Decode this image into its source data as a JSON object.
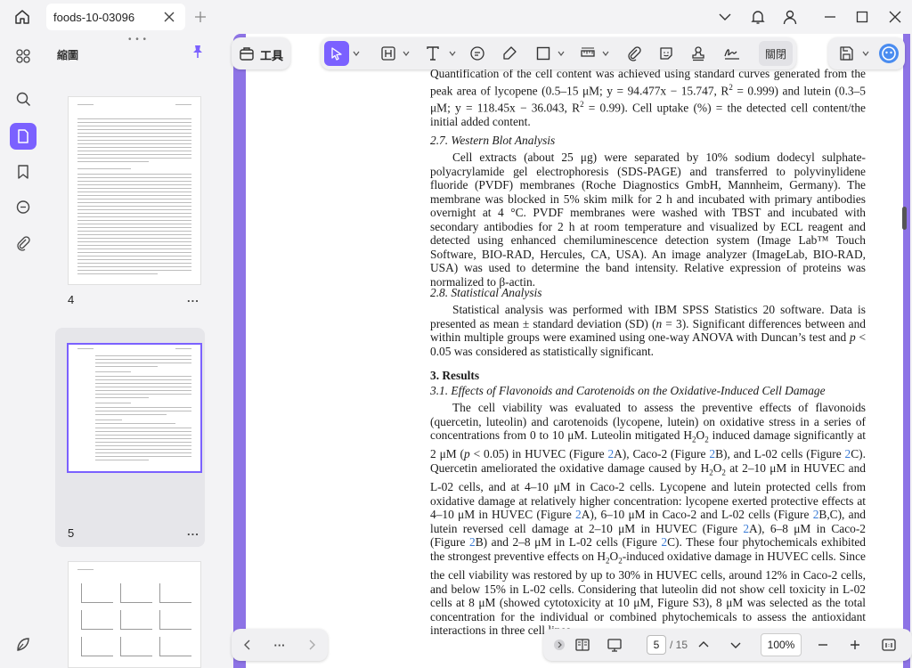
{
  "window": {
    "tab_title": "foods-10-03096"
  },
  "sidebar": {
    "title": "縮圖",
    "thumbnails": [
      {
        "page": "4",
        "more": "..."
      },
      {
        "page": "5",
        "more": "..."
      }
    ]
  },
  "toolbar": {
    "tools_label": "工具",
    "close_label": "關閉"
  },
  "document": {
    "p1": "Quantification of the cell content was achieved using standard curves generated from the peak area of lycopene (0.5–15 μM; y = 94.477x − 15.747, R",
    "p1_sup1": "2",
    "p1_b": " = 0.999) and lutein (0.3–5 μM; y = 118.45x − 36.043, R",
    "p1_sup2": "2",
    "p1_c": " = 0.99).  Cell uptake (%) = the detected cell content/the initial added content.",
    "s27": "2.7. Western Blot Analysis",
    "p2": "Cell extracts (about 25 μg) were separated by 10% sodium dodecyl sulphate-polyacrylamide gel electrophoresis (SDS-PAGE) and transferred to polyvinylidene fluoride (PVDF) membranes (Roche Diagnostics GmbH, Mannheim, Germany). The membrane was blocked in 5% skim milk for 2 h and incubated with primary antibodies overnight at 4 °C. PVDF membranes were washed with TBST and incubated with secondary antibodies for 2 h at room temperature and visualized by ECL reagent and detected using enhanced chemiluminescence detection system (Image Lab™ Touch Software, BIO-RAD, Hercules, CA, USA). An image analyzer (ImageLab, BIO-RAD, USA) was used to determine the band intensity. Relative expression of proteins was normalized to β-actin.",
    "s28": "2.8. Statistical Analysis",
    "p3a": "Statistical analysis was performed with IBM SPSS Statistics 20 software.  Data is presented as mean ± standard deviation (SD) (",
    "p3n": "n",
    "p3b": " = 3). Significant differences between and within multiple groups were examined using one-way ANOVA with Duncan’s test and ",
    "p3p": "p",
    "p3c": " < 0.05 was considered as statistically significant.",
    "h3": "3. Results",
    "s31": "3.1. Effects of Flavonoids and Carotenoids on the Oxidative-Induced Cell Damage",
    "p4_1": "The cell viability was evaluated to assess the preventive effects of flavonoids (quercetin, luteolin) and carotenoids (lycopene, lutein) on oxidative stress in a series of concentrations from 0 to 10 μM. Luteolin mitigated H",
    "p4_2": "O",
    "p4_3": " induced damage significantly at 2 μM (",
    "p4_p": "p",
    "p4_4": " < 0.05) in HUVEC (Figure ",
    "fig2": "2",
    "p4_5": "A), Caco-2 (Figure ",
    "p4_6": "B), and L-02 cells (Figure ",
    "p4_7": "C). Quercetin ameliorated the oxidative damage caused by H",
    "p4_8": " at 2–10 μM in HUVEC and L-02 cells, and at 4–10 μM in Caco-2 cells. Lycopene and lutein protected cells from oxidative damage at relatively higher concentration: lycopene exerted protective effects at 4–10 μM in HUVEC (Figure ",
    "p4_9": "A), 6–10 μM in Caco-2 and L-02 cells (Figure ",
    "p4_10": "B,C), and lutein reversed cell damage at 2–10 μM in HUVEC (Figure ",
    "p4_11": "A), 6–8 μM in Caco-2 (Figure ",
    "p4_12": "B) and 2–8 μM in L-02 cells (Figure ",
    "p4_13": "C). These four phytochemicals exhibited the strongest preventive effects on H",
    "p4_14": "-induced oxidative damage in HUVEC cells. Since the cell viability was restored by up to 30% in HUVEC cells, around 12% in Caco-2 cells, and below 15% in L-02 cells. Considering that luteolin did not show cell toxicity in L-02 cells at 8 μM (showed cytotoxicity at 10 μM, Figure S3), 8 μM was selected as the total concentration for the individual or combined phytochemicals to assess the antioxidant interactions in three cell lines.",
    "sub2": "2"
  },
  "pagination": {
    "current": "5",
    "total": "/ 15",
    "more": "···",
    "zoom": "100%"
  },
  "colors": {
    "accent": "#7b61ff",
    "frame": "#8d73e6",
    "link": "#3a7bd5"
  }
}
